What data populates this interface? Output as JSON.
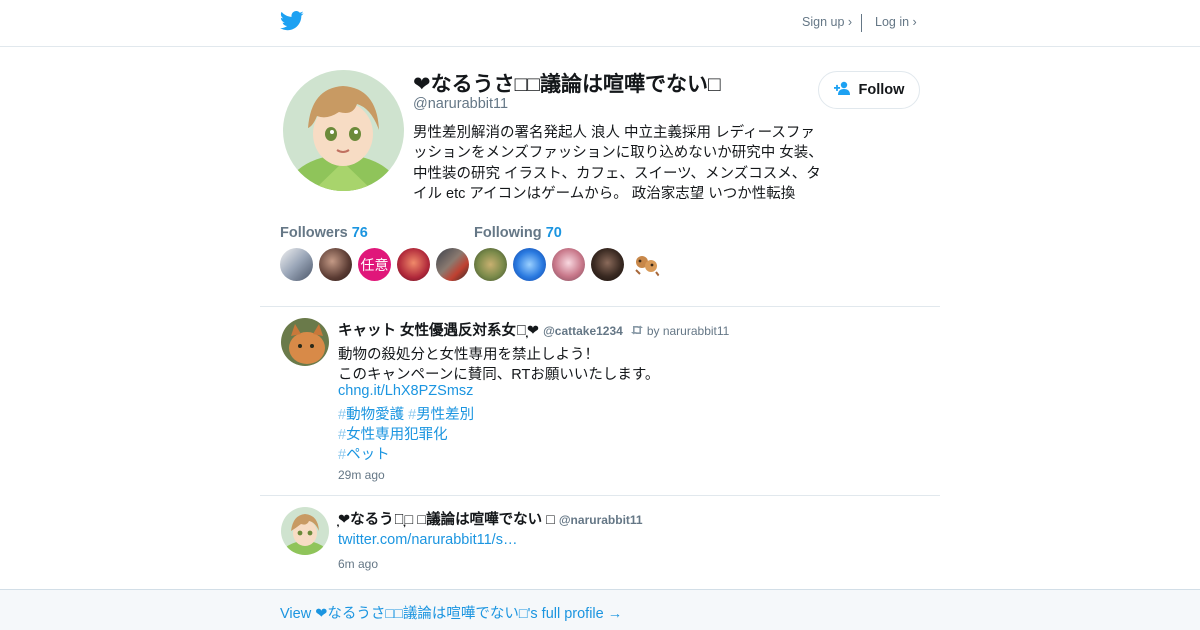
{
  "header": {
    "logo_icon": "twitter-bird-icon",
    "signup_label": "Sign up ›",
    "login_label": "Log in ›",
    "brand_color": "#1da1f2"
  },
  "profile": {
    "name": "❤なるうさ□□議論は喧嘩でない□",
    "handle": "@narurabbit11",
    "bio": "男性差別解消の署名発起人 浪人 中立主義採用 レディースファッションをメンズファッションに取り込めないか研究中 女装、中性装の研究 イラスト、カフェ、スイーツ、メンズコスメ、タイル etc アイコンはゲームから。 政治家志望 いつか性転換",
    "follow_label": "Follow",
    "followers_label": "Followers",
    "followers_count": "76",
    "following_label": "Following",
    "following_count": "70",
    "follower_avatars": [
      "avatar-1",
      "avatar-2",
      "任意",
      "avatar-4",
      "avatar-5"
    ],
    "following_avatars": [
      "avatar-1",
      "avatar-2",
      "avatar-3",
      "avatar-4",
      "avatar-5"
    ]
  },
  "tweets": [
    {
      "author": "キャット 女性優遇反対系女子̦❤",
      "handle": "@cattake1234",
      "retweet_note": "by narurabbit11",
      "lines": [
        "動物の殺処分と女性専用を禁止しよう！",
        "このキャンペーンに賛同、RTお願いいたします。"
      ],
      "link": "chng.it/LhX8PZSmsz",
      "hashtags_row1": [
        "動物愛護",
        "男性差別"
      ],
      "hashtags_row2": [
        "女性専用犯罪化"
      ],
      "hashtags_row3": [
        "ペット"
      ],
      "time": "29m ago"
    },
    {
      "author": "̦❤なるうさ̦□ □議論は喧嘩でない □",
      "handle": "@narurabbit11",
      "link": "twitter.com/narurabbit11/s…",
      "time": "6m ago"
    }
  ],
  "footer": {
    "link_label": "View ❤なるうさ□□議論は喧嘩でない□'s full profile →"
  }
}
